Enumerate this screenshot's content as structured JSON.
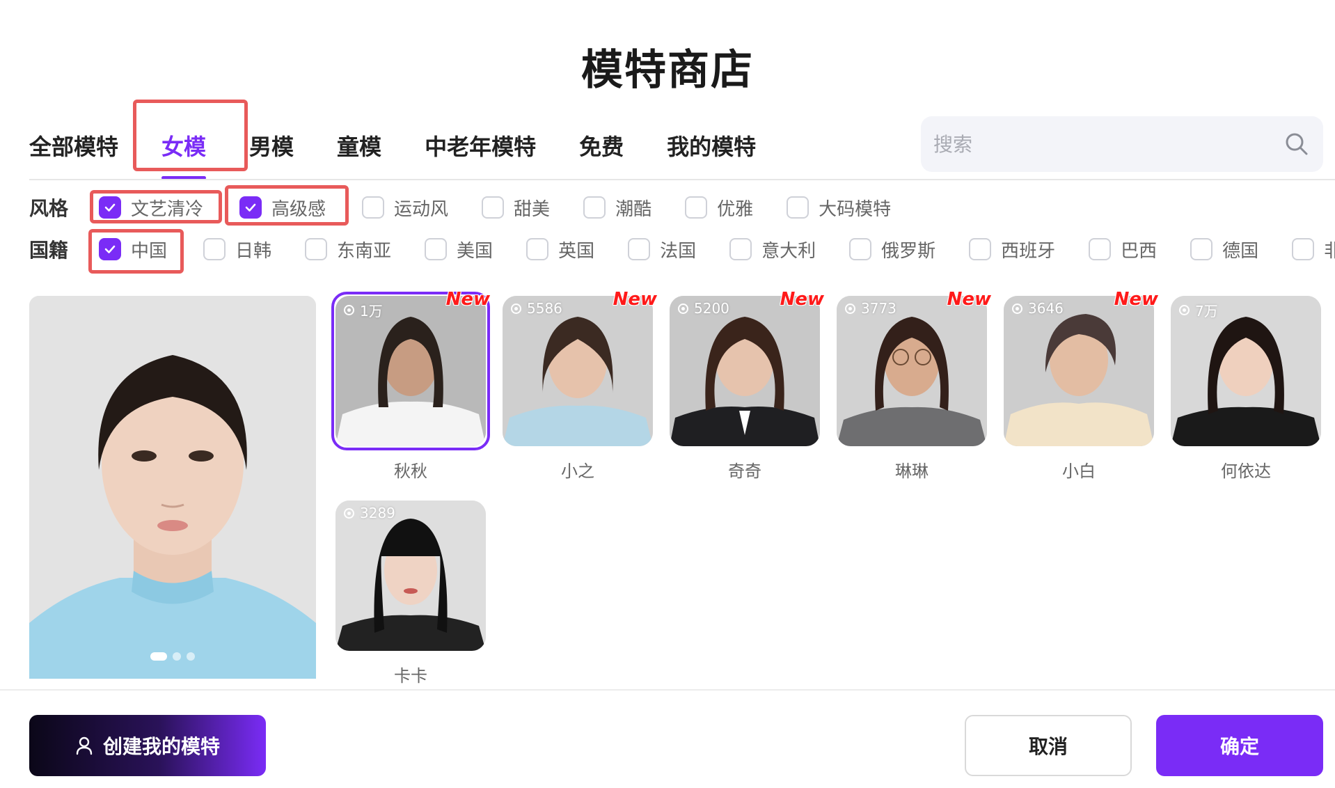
{
  "page_title": "模特商店",
  "tabs": [
    {
      "label": "全部模特",
      "active": false
    },
    {
      "label": "女模",
      "active": true
    },
    {
      "label": "男模",
      "active": false
    },
    {
      "label": "童模",
      "active": false
    },
    {
      "label": "中老年模特",
      "active": false
    },
    {
      "label": "免费",
      "active": false
    },
    {
      "label": "我的模特",
      "active": false
    }
  ],
  "search": {
    "placeholder": "搜索"
  },
  "filters": {
    "style": {
      "label": "风格",
      "options": [
        {
          "label": "文艺清冷",
          "checked": true
        },
        {
          "label": "高级感",
          "checked": true
        },
        {
          "label": "运动风",
          "checked": false
        },
        {
          "label": "甜美",
          "checked": false
        },
        {
          "label": "潮酷",
          "checked": false
        },
        {
          "label": "优雅",
          "checked": false
        },
        {
          "label": "大码模特",
          "checked": false
        }
      ]
    },
    "nationality": {
      "label": "国籍",
      "options": [
        {
          "label": "中国",
          "checked": true
        },
        {
          "label": "日韩",
          "checked": false
        },
        {
          "label": "东南亚",
          "checked": false
        },
        {
          "label": "美国",
          "checked": false
        },
        {
          "label": "英国",
          "checked": false
        },
        {
          "label": "法国",
          "checked": false
        },
        {
          "label": "意大利",
          "checked": false
        },
        {
          "label": "俄罗斯",
          "checked": false
        },
        {
          "label": "西班牙",
          "checked": false
        },
        {
          "label": "巴西",
          "checked": false
        },
        {
          "label": "德国",
          "checked": false
        },
        {
          "label": "非洲",
          "checked": false
        }
      ]
    }
  },
  "models": [
    {
      "name": "秋秋",
      "count": "1万",
      "new": true,
      "selected": true
    },
    {
      "name": "小之",
      "count": "5586",
      "new": true,
      "selected": false
    },
    {
      "name": "奇奇",
      "count": "5200",
      "new": true,
      "selected": false
    },
    {
      "name": "琳琳",
      "count": "3773",
      "new": true,
      "selected": false
    },
    {
      "name": "小白",
      "count": "3646",
      "new": true,
      "selected": false
    },
    {
      "name": "何依达",
      "count": "7万",
      "new": false,
      "selected": false
    },
    {
      "name": "卡卡",
      "count": "3289",
      "new": false,
      "selected": false
    }
  ],
  "new_badge": "New",
  "buttons": {
    "create": "创建我的模特",
    "cancel": "取消",
    "confirm": "确定"
  }
}
